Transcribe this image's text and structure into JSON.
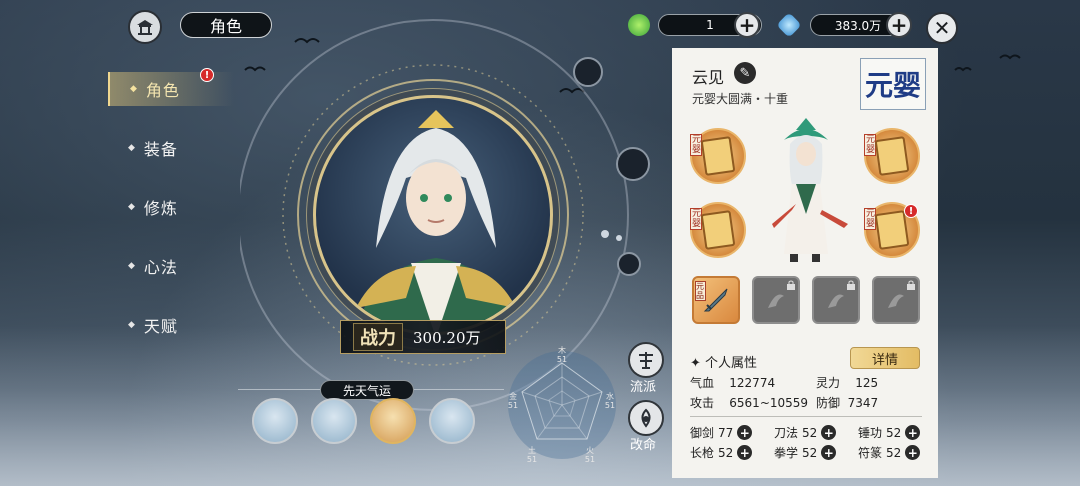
{
  "header": {
    "title": "角色",
    "resource1_value": "1",
    "resource2_value": "383.0万"
  },
  "menu": {
    "items": [
      {
        "label": "角色",
        "active": true,
        "alert": "!"
      },
      {
        "label": "装备"
      },
      {
        "label": "修炼"
      },
      {
        "label": "心法"
      },
      {
        "label": "天赋"
      }
    ]
  },
  "center": {
    "power_label": "战力",
    "power_value": "300.20万",
    "fortune_label": "先天气运",
    "side_buttons": [
      {
        "label": "流派",
        "icon": "sect-icon"
      },
      {
        "label": "改命",
        "icon": "fate-icon"
      }
    ]
  },
  "radar": {
    "axes": [
      {
        "label": "木",
        "value": "51"
      },
      {
        "label": "水",
        "value": "51"
      },
      {
        "label": "火",
        "value": "51"
      },
      {
        "label": "土",
        "value": "51"
      },
      {
        "label": "金",
        "value": "51"
      }
    ]
  },
  "character": {
    "name": "云见",
    "realm": "元婴大圆满・十重",
    "realm_seal": "元婴",
    "equip_tag": "元婴",
    "weapon_tag": "元品",
    "attributes_title": "个人属性",
    "detail_label": "详情",
    "stats": [
      {
        "label": "气血",
        "value": "122774"
      },
      {
        "label": "灵力",
        "value": "125"
      },
      {
        "label": "攻击",
        "value": "6561~10559"
      },
      {
        "label": "防御",
        "value": "7347"
      }
    ],
    "skills": [
      {
        "label": "御剑",
        "value": "77"
      },
      {
        "label": "刀法",
        "value": "52"
      },
      {
        "label": "锤功",
        "value": "52"
      },
      {
        "label": "长枪",
        "value": "52"
      },
      {
        "label": "拳学",
        "value": "52"
      },
      {
        "label": "符篆",
        "value": "52"
      }
    ]
  },
  "colors": {
    "accent_gold": "#e3bc64",
    "panel_bg": "#f4f3ef",
    "alert_red": "#d62a2a"
  }
}
